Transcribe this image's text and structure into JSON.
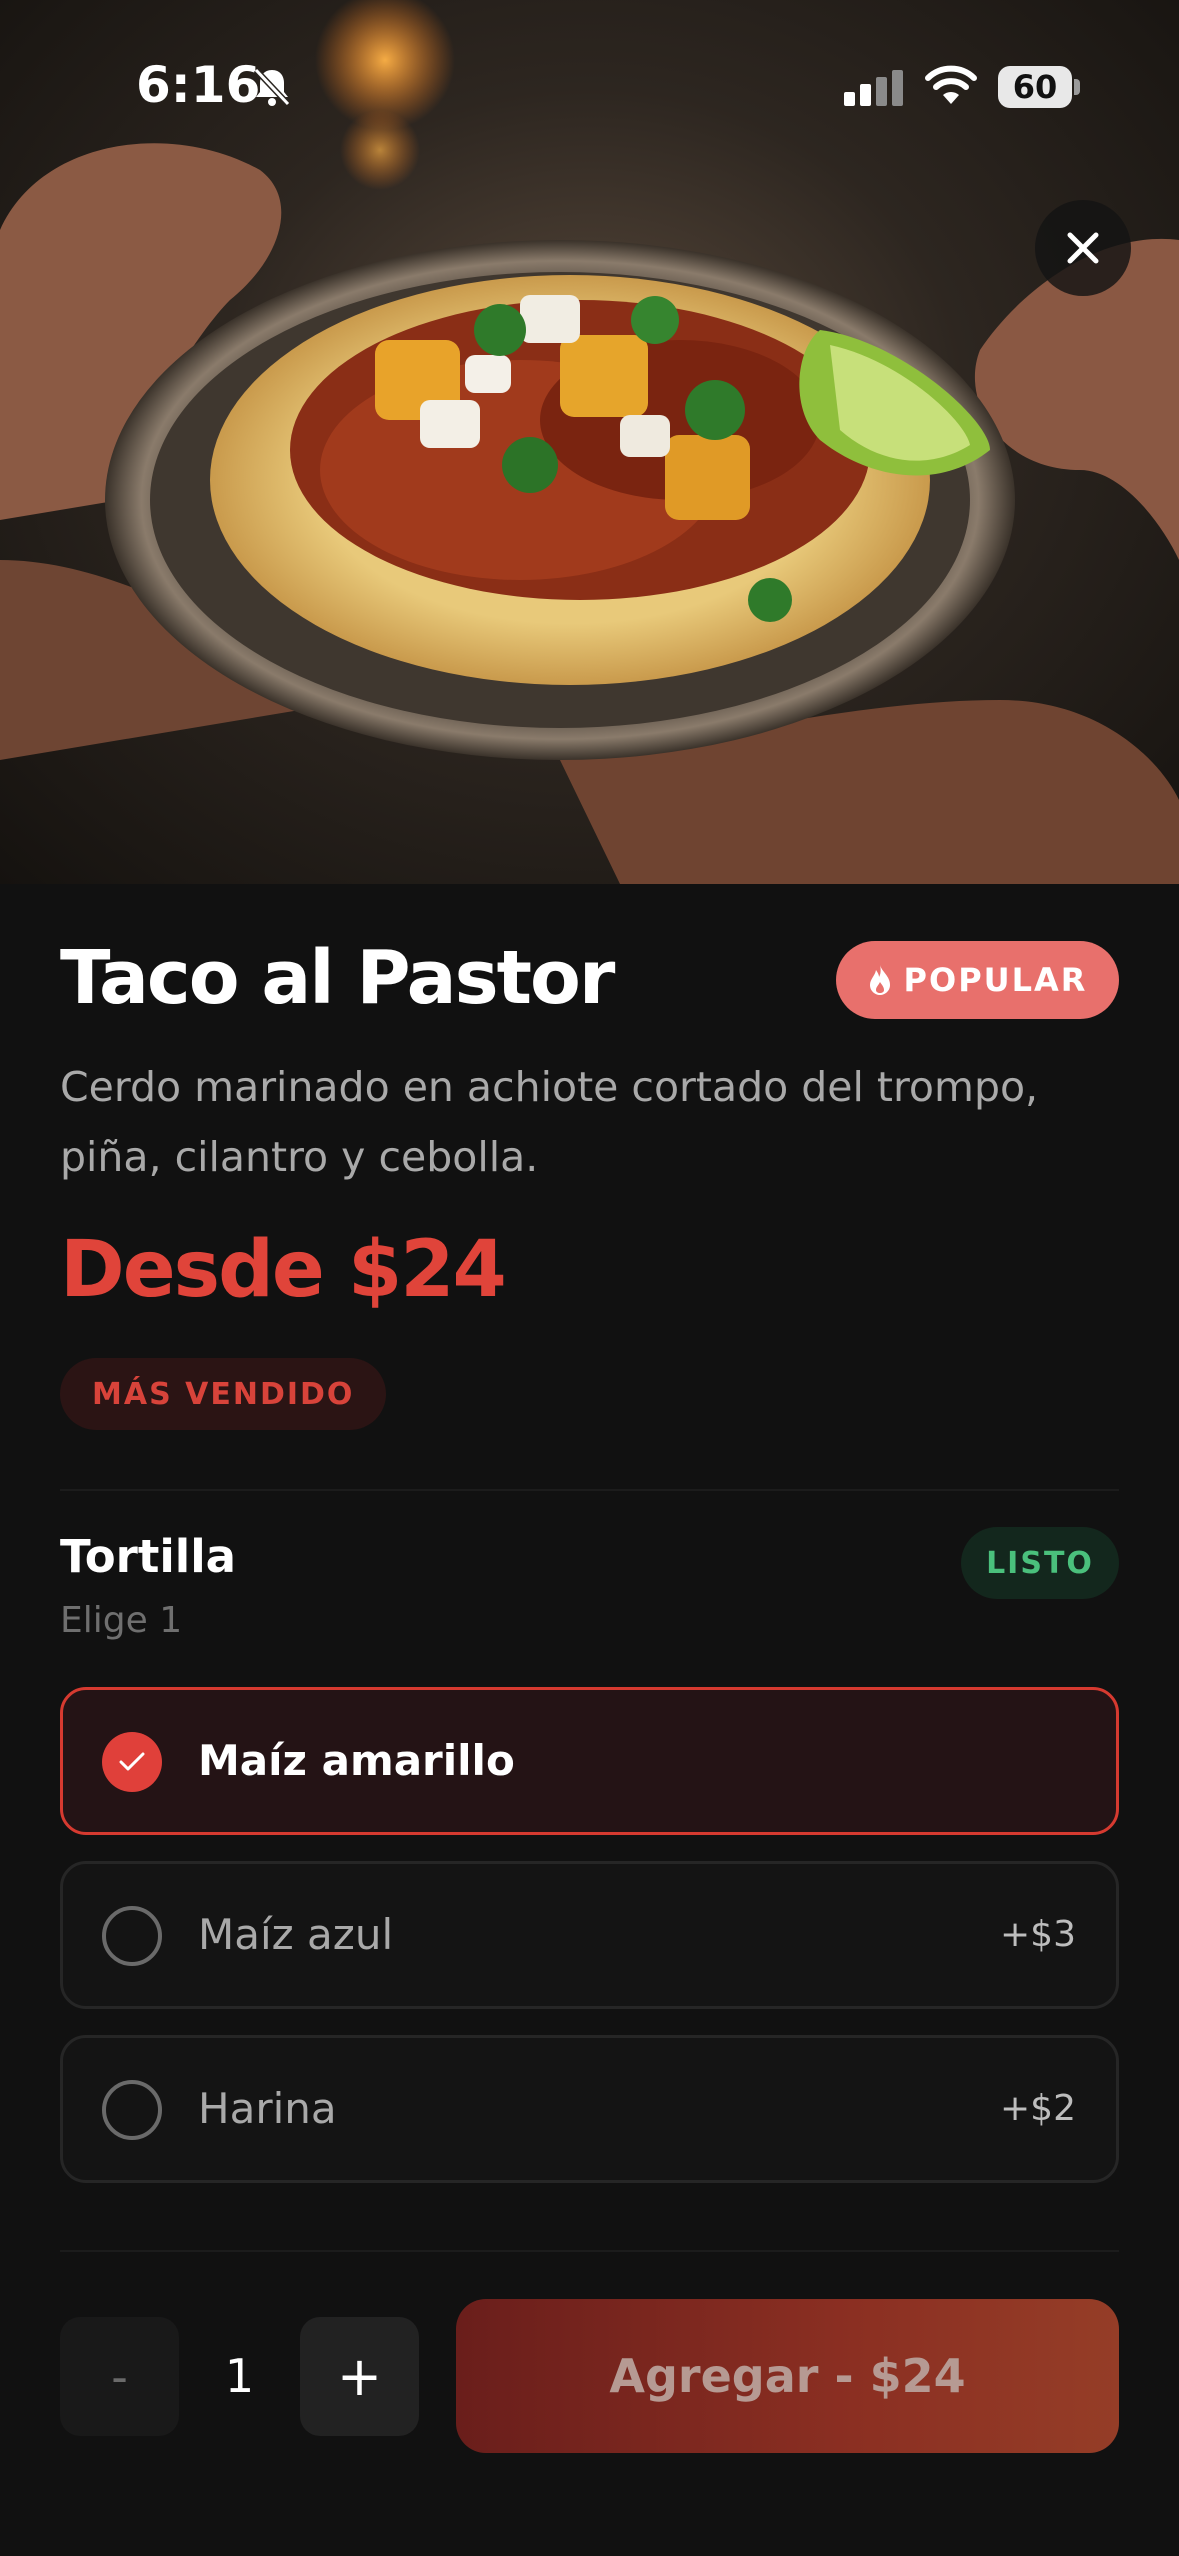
{
  "status_bar": {
    "time": "6:16",
    "battery": "60",
    "icons": [
      "bell-slash-icon",
      "signal-icon",
      "wifi-icon",
      "battery-icon"
    ]
  },
  "hero": {
    "close_icon": "close-icon"
  },
  "product": {
    "title": "Taco al Pastor",
    "badge": "POPULAR",
    "badge_icon": "flame-icon",
    "description": "Cerdo marinado en achiote cortado del trompo, piña, cilantro y cebolla.",
    "price": "Desde $24",
    "tag": "MÁS VENDIDO"
  },
  "tortilla": {
    "title": "Tortilla",
    "subtitle": "Elige 1",
    "status": "LISTO",
    "options": [
      {
        "label": "Maíz amarillo",
        "price": "",
        "selected": true
      },
      {
        "label": "Maíz azul",
        "price": "+$3",
        "selected": false
      },
      {
        "label": "Harina",
        "price": "+$2",
        "selected": false
      }
    ]
  },
  "footer": {
    "minus": "-",
    "quantity": "1",
    "plus": "+",
    "add_button": "Agregar - $24"
  },
  "colors": {
    "background": "#111111",
    "accent": "#e0443a",
    "popular_badge": "#e8706c",
    "ready_green": "#4ac07c"
  }
}
